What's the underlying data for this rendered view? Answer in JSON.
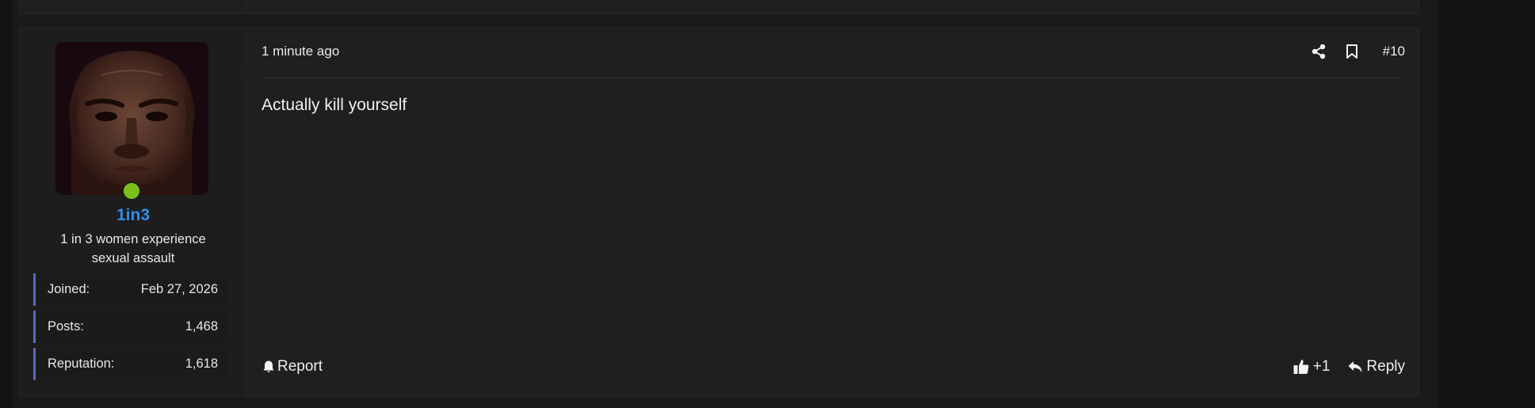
{
  "post": {
    "date": "1 minute ago",
    "number": "#10",
    "body": "Actually kill yourself",
    "actions": {
      "share_icon": "share-icon",
      "bookmark_icon": "bookmark-icon",
      "report_label": "Report",
      "like_count": "+1",
      "reply_label": "Reply"
    }
  },
  "user": {
    "name": "1in3",
    "title": "1 in 3 women experience sexual assault",
    "online": true,
    "stats": [
      {
        "label": "Joined:",
        "value": "Feb 27, 2026"
      },
      {
        "label": "Posts:",
        "value": "1,468"
      },
      {
        "label": "Reputation:",
        "value": "1,618"
      }
    ]
  },
  "colors": {
    "username": "#2f8fe6",
    "online": "#7cbf1a",
    "stat_accent": "#5a67c8"
  }
}
